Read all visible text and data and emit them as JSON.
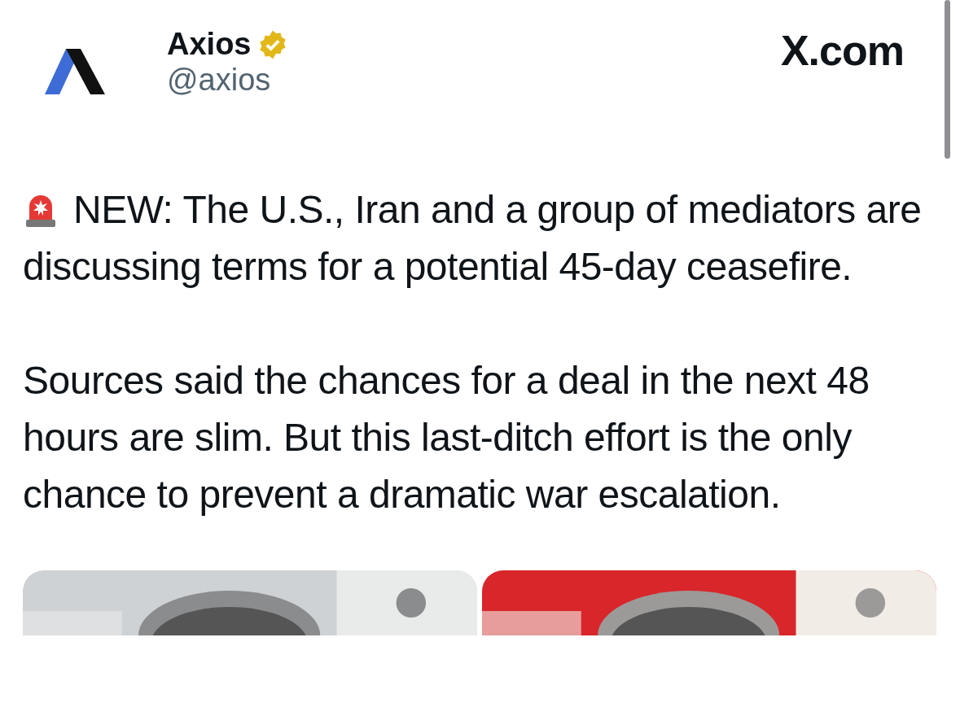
{
  "author": {
    "name": "Axios",
    "handle": "@axios",
    "verified": true
  },
  "source": "X.com",
  "paragraphs": [
    {
      "text": "NEW: The U.S., Iran and a group of mediators are discussing terms for a potential 45-day ceasefire.",
      "siren": true
    },
    {
      "text": "Sources said the chances for a deal in the next 48 hours are slim. But this last-ditch effort is the only chance to prevent a dramatic war escalation.",
      "siren": false
    }
  ]
}
